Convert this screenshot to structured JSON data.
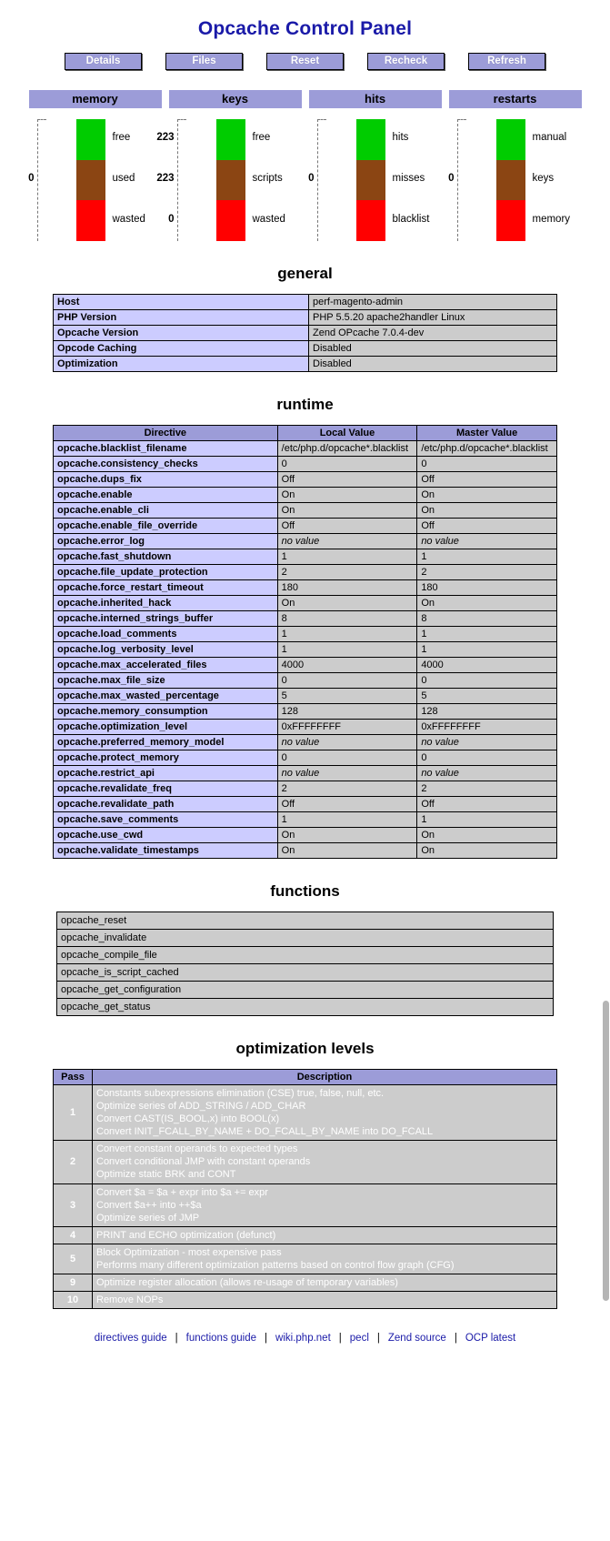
{
  "header": {
    "title": "Opcache Control Panel",
    "title_color": "#1a1aa8",
    "nav": [
      {
        "label": "Details",
        "name": "details"
      },
      {
        "label": "Files",
        "name": "files"
      },
      {
        "label": "Reset",
        "name": "reset"
      },
      {
        "label": "Recheck",
        "name": "recheck"
      },
      {
        "label": "Refresh",
        "name": "refresh"
      }
    ]
  },
  "chart_data": [
    {
      "type": "bar",
      "title": "memory",
      "stacked": true,
      "categories": [
        "free",
        "used",
        "wasted"
      ],
      "values": [
        0,
        0,
        0
      ],
      "value_labels": [
        "",
        "0",
        ""
      ],
      "colors": [
        "#00cc00",
        "#8b4513",
        "#ff0000"
      ]
    },
    {
      "type": "bar",
      "title": "keys",
      "stacked": true,
      "categories": [
        "free",
        "scripts",
        "wasted"
      ],
      "values": [
        223,
        223,
        0
      ],
      "value_labels": [
        "223",
        "223",
        "0"
      ],
      "colors": [
        "#00cc00",
        "#8b4513",
        "#ff0000"
      ]
    },
    {
      "type": "bar",
      "title": "hits",
      "stacked": true,
      "categories": [
        "hits",
        "misses",
        "blacklist"
      ],
      "values": [
        0,
        0,
        0
      ],
      "value_labels": [
        "",
        "0",
        ""
      ],
      "colors": [
        "#00cc00",
        "#8b4513",
        "#ff0000"
      ]
    },
    {
      "type": "bar",
      "title": "restarts",
      "stacked": true,
      "categories": [
        "manual",
        "keys",
        "memory"
      ],
      "values": [
        0,
        0,
        0
      ],
      "value_labels": [
        "",
        "0",
        ""
      ],
      "colors": [
        "#00cc00",
        "#8b4513",
        "#ff0000"
      ]
    }
  ],
  "gauges": [
    {
      "title": "memory",
      "segments": [
        {
          "label": "free",
          "value": "",
          "color": "#00cc00"
        },
        {
          "label": "used",
          "value": "0",
          "color": "#8b4513"
        },
        {
          "label": "wasted",
          "value": "",
          "color": "#ff0000"
        }
      ]
    },
    {
      "title": "keys",
      "segments": [
        {
          "label": "free",
          "value": "223",
          "color": "#00cc00"
        },
        {
          "label": "scripts",
          "value": "223",
          "color": "#8b4513"
        },
        {
          "label": "wasted",
          "value": "0",
          "color": "#ff0000"
        }
      ]
    },
    {
      "title": "hits",
      "segments": [
        {
          "label": "hits",
          "value": "",
          "color": "#00cc00"
        },
        {
          "label": "misses",
          "value": "0",
          "color": "#8b4513"
        },
        {
          "label": "blacklist",
          "value": "",
          "color": "#ff0000"
        }
      ]
    },
    {
      "title": "restarts",
      "segments": [
        {
          "label": "manual",
          "value": "",
          "color": "#00cc00"
        },
        {
          "label": "keys",
          "value": "0",
          "color": "#8b4513"
        },
        {
          "label": "memory",
          "value": "",
          "color": "#ff0000"
        }
      ]
    }
  ],
  "general": {
    "heading": "general",
    "rows": [
      {
        "key": "Host",
        "value": "perf-magento-admin"
      },
      {
        "key": "PHP Version",
        "value": "PHP 5.5.20 apache2handler Linux"
      },
      {
        "key": "Opcache Version",
        "value": "Zend OPcache 7.0.4-dev"
      },
      {
        "key": "Opcode Caching",
        "value": "Disabled"
      },
      {
        "key": "Optimization",
        "value": "Disabled"
      }
    ]
  },
  "runtime": {
    "heading": "runtime",
    "columns": [
      "Directive",
      "Local Value",
      "Master Value"
    ],
    "rows": [
      {
        "directive": "opcache.blacklist_filename",
        "local": "/etc/php.d/opcache*.blacklist",
        "master": "/etc/php.d/opcache*.blacklist",
        "italic": false
      },
      {
        "directive": "opcache.consistency_checks",
        "local": "0",
        "master": "0",
        "italic": false
      },
      {
        "directive": "opcache.dups_fix",
        "local": "Off",
        "master": "Off",
        "italic": false
      },
      {
        "directive": "opcache.enable",
        "local": "On",
        "master": "On",
        "italic": false
      },
      {
        "directive": "opcache.enable_cli",
        "local": "On",
        "master": "On",
        "italic": false
      },
      {
        "directive": "opcache.enable_file_override",
        "local": "Off",
        "master": "Off",
        "italic": false
      },
      {
        "directive": "opcache.error_log",
        "local": "no value",
        "master": "no value",
        "italic": true
      },
      {
        "directive": "opcache.fast_shutdown",
        "local": "1",
        "master": "1",
        "italic": false
      },
      {
        "directive": "opcache.file_update_protection",
        "local": "2",
        "master": "2",
        "italic": false
      },
      {
        "directive": "opcache.force_restart_timeout",
        "local": "180",
        "master": "180",
        "italic": false
      },
      {
        "directive": "opcache.inherited_hack",
        "local": "On",
        "master": "On",
        "italic": false
      },
      {
        "directive": "opcache.interned_strings_buffer",
        "local": "8",
        "master": "8",
        "italic": false
      },
      {
        "directive": "opcache.load_comments",
        "local": "1",
        "master": "1",
        "italic": false
      },
      {
        "directive": "opcache.log_verbosity_level",
        "local": "1",
        "master": "1",
        "italic": false
      },
      {
        "directive": "opcache.max_accelerated_files",
        "local": "4000",
        "master": "4000",
        "italic": false
      },
      {
        "directive": "opcache.max_file_size",
        "local": "0",
        "master": "0",
        "italic": false
      },
      {
        "directive": "opcache.max_wasted_percentage",
        "local": "5",
        "master": "5",
        "italic": false
      },
      {
        "directive": "opcache.memory_consumption",
        "local": "128",
        "master": "128",
        "italic": false
      },
      {
        "directive": "opcache.optimization_level",
        "local": "0xFFFFFFFF",
        "master": "0xFFFFFFFF",
        "italic": false
      },
      {
        "directive": "opcache.preferred_memory_model",
        "local": "no value",
        "master": "no value",
        "italic": true
      },
      {
        "directive": "opcache.protect_memory",
        "local": "0",
        "master": "0",
        "italic": false
      },
      {
        "directive": "opcache.restrict_api",
        "local": "no value",
        "master": "no value",
        "italic": true
      },
      {
        "directive": "opcache.revalidate_freq",
        "local": "2",
        "master": "2",
        "italic": false
      },
      {
        "directive": "opcache.revalidate_path",
        "local": "Off",
        "master": "Off",
        "italic": false
      },
      {
        "directive": "opcache.save_comments",
        "local": "1",
        "master": "1",
        "italic": false
      },
      {
        "directive": "opcache.use_cwd",
        "local": "On",
        "master": "On",
        "italic": false
      },
      {
        "directive": "opcache.validate_timestamps",
        "local": "On",
        "master": "On",
        "italic": false
      }
    ]
  },
  "functions": {
    "heading": "functions",
    "items": [
      "opcache_reset",
      "opcache_invalidate",
      "opcache_compile_file",
      "opcache_is_script_cached",
      "opcache_get_configuration",
      "opcache_get_status"
    ]
  },
  "optimization_levels": {
    "heading": "optimization levels",
    "columns": [
      "Pass",
      "Description"
    ],
    "rows": [
      {
        "pass": "1",
        "lines": [
          "Constants subexpressions elimination (CSE) true, false, null, etc.",
          "Optimize series of ADD_STRING / ADD_CHAR",
          "Convert CAST(IS_BOOL,x) into BOOL(x)",
          "Convert INIT_FCALL_BY_NAME + DO_FCALL_BY_NAME into DO_FCALL"
        ]
      },
      {
        "pass": "2",
        "lines": [
          "Convert constant operands to expected types",
          "Convert conditional JMP with constant operands",
          "Optimize static BRK and CONT"
        ]
      },
      {
        "pass": "3",
        "lines": [
          "Convert $a = $a + expr into $a += expr",
          "Convert $a++ into ++$a",
          "Optimize series of JMP"
        ]
      },
      {
        "pass": "4",
        "lines": [
          "PRINT and ECHO optimization (defunct)"
        ]
      },
      {
        "pass": "5",
        "lines": [
          "Block Optimization - most expensive pass",
          "Performs many different optimization patterns based on control flow graph (CFG)"
        ]
      },
      {
        "pass": "9",
        "lines": [
          "Optimize register allocation (allows re-usage of temporary variables)"
        ]
      },
      {
        "pass": "10",
        "lines": [
          "Remove NOPs"
        ]
      }
    ]
  },
  "footer": {
    "links": [
      "directives guide",
      "functions guide",
      "wiki.php.net",
      "pecl",
      "Zend source",
      "OCP latest"
    ],
    "separator": "|"
  }
}
